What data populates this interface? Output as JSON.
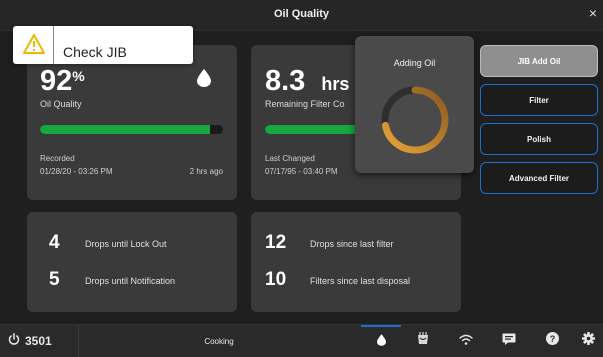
{
  "window": {
    "title": "Oil Quality",
    "close_glyph": "×"
  },
  "alert": {
    "text": "Check JIB",
    "icon": "warning-triangle-icon",
    "color": "#f2b705"
  },
  "oil_quality_card": {
    "value": "92",
    "unit": "%",
    "label": "Oil Quality",
    "icon": "droplet-icon",
    "progress": 0.93,
    "recorded_label": "Recorded",
    "recorded_date": "01/28/20 - 03:26 PM",
    "recorded_ago": "2 hrs ago"
  },
  "filter_life_card": {
    "value": "8.3",
    "unit": "hrs",
    "label": "Remaining Filter Co",
    "progress": 0.6,
    "changed_label": "Last Changed",
    "changed_date": "07/17/95 - 03:40 PM"
  },
  "adding_oil_popup": {
    "title": "Adding Oil",
    "progress": 0.72
  },
  "actions": [
    {
      "label": "JIB Add Oil",
      "active": true
    },
    {
      "label": "Filter",
      "active": false
    },
    {
      "label": "Polish",
      "active": false
    },
    {
      "label": "Advanced Filter",
      "active": false
    }
  ],
  "drops_card": {
    "rows": [
      {
        "count": "4",
        "label": "Drops until Lock Out"
      },
      {
        "count": "5",
        "label": "Drops until Notification"
      }
    ]
  },
  "filter_stats_card": {
    "rows": [
      {
        "count": "12",
        "label": "Drops since last filter"
      },
      {
        "count": "10",
        "label": "Filters since last disposal"
      }
    ]
  },
  "bottom_bar": {
    "fryer_label": "3501",
    "status_label": "Cooking",
    "icons": [
      "oil-drop-icon",
      "fryer-icon",
      "wifi-icon",
      "message-icon",
      "help-icon",
      "settings-icon"
    ],
    "active_icon": "oil-drop-icon"
  },
  "colors": {
    "accent": "#1f6fcc",
    "progress": "#17a83f",
    "card": "#3a3a3a",
    "background": "#1f1f1f"
  }
}
